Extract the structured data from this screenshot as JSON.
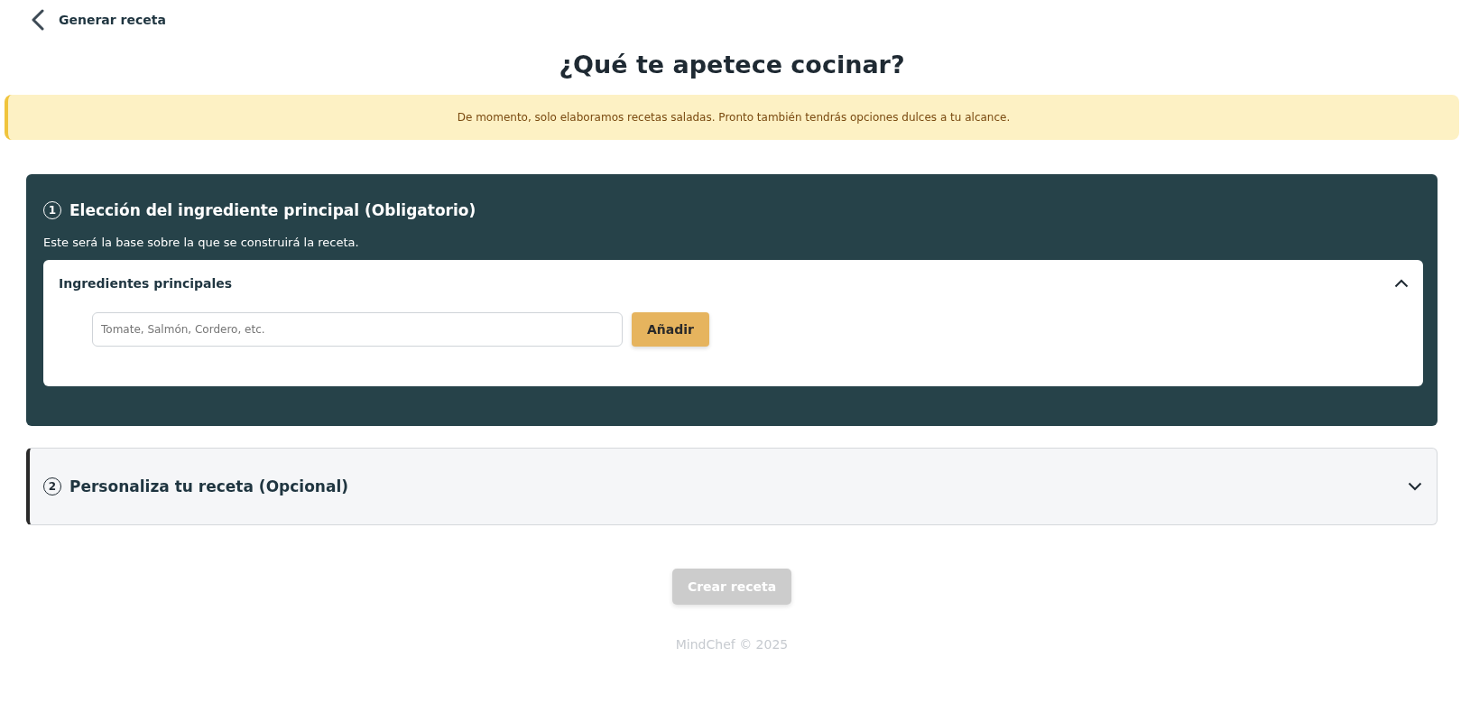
{
  "header": {
    "back_label": "Generar receta"
  },
  "title": "¿Qué te apetece cocinar?",
  "notice": "De momento, solo elaboramos recetas saladas. Pronto también tendrás opciones dulces a tu alcance.",
  "sections": [
    {
      "number": "1",
      "title": "Elección del ingrediente principal (Obligatorio)",
      "expanded": true,
      "description": "Este será la base sobre la que se construirá la receta.",
      "panel": {
        "title": "Ingredientes principales",
        "expanded": true,
        "input": {
          "placeholder": "Tomate, Salmón, Cordero, etc."
        },
        "button": "Añadir"
      }
    },
    {
      "number": "2",
      "title": "Personaliza tu receta (Opcional)",
      "expanded": false
    }
  ],
  "create_button": {
    "label": "Crear receta",
    "disabled": true
  },
  "footer": "MindChef © 2025"
}
